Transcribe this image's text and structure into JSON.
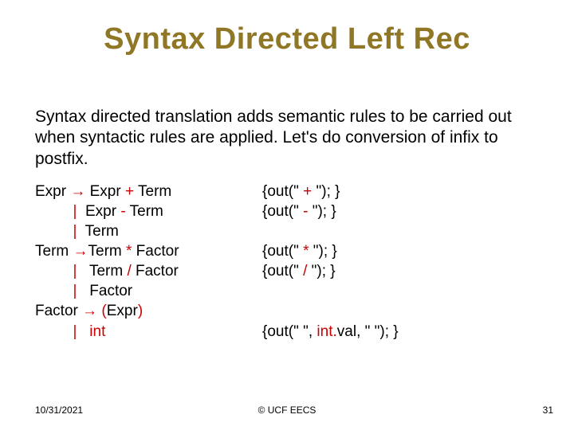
{
  "title": "Syntax Directed Left Rec",
  "intro": "Syntax directed translation adds semantic rules to be carried out when syntactic rules are applied. Let's do conversion of infix to postfix.",
  "rules": [
    {
      "lhs": "Expr ",
      "arrow": "→",
      "rhs_pre": " Expr ",
      "op": "+",
      "rhs_post": " Term",
      "action_pre": "{out(\" ",
      "action_op": "+",
      "action_post": " \"); }"
    },
    {
      "lhs": "         ",
      "arrow": "|",
      "rhs_pre": "  Expr ",
      "op": "-",
      "rhs_post": " Term",
      "action_pre": "{out(\" ",
      "action_op": "-",
      "action_post": " \"); }"
    },
    {
      "lhs": "         ",
      "arrow": "|",
      "rhs_pre": "  Term",
      "op": "",
      "rhs_post": "",
      "action_pre": "",
      "action_op": "",
      "action_post": ""
    },
    {
      "lhs": "Term ",
      "arrow": "→",
      "rhs_pre": "Term ",
      "op": "*",
      "rhs_post": " Factor",
      "action_pre": "{out(\" ",
      "action_op": "*",
      "action_post": " \"); }"
    },
    {
      "lhs": "         ",
      "arrow": "|",
      "rhs_pre": "   Term ",
      "op": "/",
      "rhs_post": " Factor",
      "action_pre": "{out(\" ",
      "action_op": "/",
      "action_post": " \"); }"
    },
    {
      "lhs": "         ",
      "arrow": "|",
      "rhs_pre": "   Factor",
      "op": "",
      "rhs_post": "",
      "action_pre": "",
      "action_op": "",
      "action_post": ""
    },
    {
      "lhs": "Factor ",
      "arrow": "→",
      "rhs_pre": " ",
      "op": "(",
      "rhs_mid": "Expr",
      "op2": ")",
      "rhs_post": "",
      "action_pre": "",
      "action_op": "",
      "action_post": ""
    },
    {
      "lhs": "         ",
      "arrow": "|",
      "rhs_pre": "   ",
      "op": "int",
      "rhs_post": "",
      "action_pre": "{out(\" \", ",
      "action_op": "int.",
      "action_mid": "val, \" \"); }",
      "action_post": ""
    }
  ],
  "footer": {
    "date": "10/31/2021",
    "center": "© UCF EECS",
    "page": "31"
  }
}
